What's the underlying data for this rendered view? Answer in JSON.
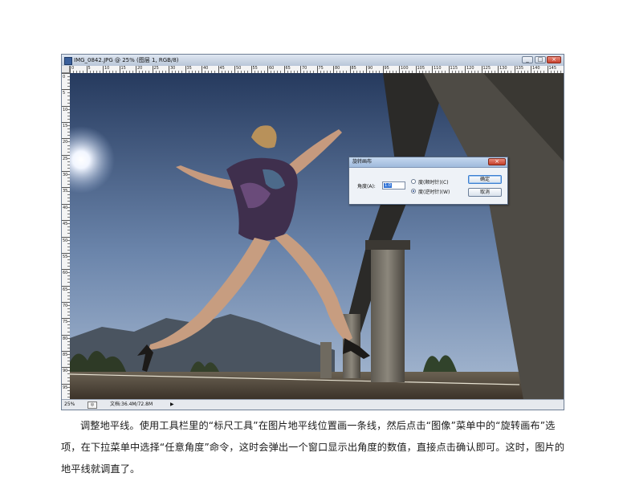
{
  "window": {
    "title": "IMG_0842.JPG @ 25% (图层 1, RGB/8)",
    "minimize": "_",
    "maximize": "□",
    "close": "×"
  },
  "ruler": {
    "top_labels": [
      "0",
      "5",
      "10",
      "15",
      "20",
      "25",
      "30",
      "35",
      "40",
      "45",
      "50",
      "55",
      "60",
      "65",
      "70",
      "75",
      "80",
      "85",
      "90",
      "95",
      "100",
      "105",
      "110",
      "115",
      "120",
      "125",
      "130",
      "135",
      "140",
      "145"
    ],
    "left_labels": [
      "0",
      "5",
      "10",
      "15",
      "20",
      "25",
      "30",
      "35",
      "40",
      "45",
      "50",
      "55",
      "60",
      "65",
      "70",
      "75",
      "80",
      "85",
      "90",
      "95"
    ]
  },
  "status": {
    "zoom": "25%",
    "doc_info": "文档:36.4M/72.8M",
    "arrow": "▶"
  },
  "dialog": {
    "title": "旋转画布",
    "close": "×",
    "angle_label": "角度(A):",
    "angle_value": "1.0",
    "option_cw": "度(顺时针)(C)",
    "option_ccw": "度(逆时针)(W)",
    "selected_option": "ccw",
    "ok": "确定",
    "cancel": "取消"
  },
  "caption": "调整地平线。使用工具栏里的“标尺工具”在图片地平线位置画一条线，然后点击“图像”菜单中的“旋转画布”选项，在下拉菜单中选择“任意角度”命令，这时会弹出一个窗口显示出角度的数值，直接点击确认即可。这时，图片的地平线就调直了。"
}
